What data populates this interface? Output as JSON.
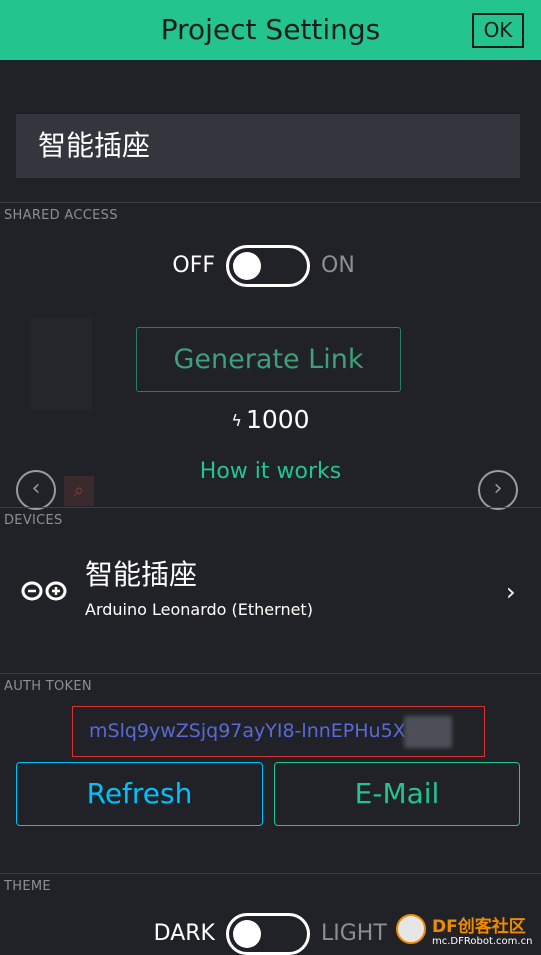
{
  "header": {
    "title": "Project Settings",
    "ok_label": "OK"
  },
  "project": {
    "name": "智能插座"
  },
  "shared_access": {
    "section_label": "SHARED ACCESS",
    "toggle_off_label": "OFF",
    "toggle_on_label": "ON",
    "toggle_state": "off",
    "generate_link_label": "Generate Link",
    "energy_icon": "lightning-icon",
    "energy_value": "1000",
    "how_it_works_label": "How it works"
  },
  "devices": {
    "section_label": "DEVICES",
    "items": [
      {
        "name": "智能插座",
        "subtitle": "Arduino Leonardo (Ethernet)",
        "icon": "arduino-icon"
      }
    ]
  },
  "auth_token": {
    "section_label": "AUTH TOKEN",
    "value": "mSlq9ywZSjq97ayYI8-lnnEPHu5XU",
    "refresh_label": "Refresh",
    "email_label": "E-Mail"
  },
  "theme": {
    "section_label": "THEME",
    "toggle_left_label": "DARK",
    "toggle_right_label": "LIGHT",
    "toggle_state": "dark"
  },
  "watermark": {
    "brand": "DF创客社区",
    "url": "mc.DFRobot.com.cn"
  },
  "colors": {
    "accent_green": "#23c48e",
    "accent_blue": "#04c0f8",
    "background": "#212227",
    "highlight_red": "#d9322e"
  }
}
